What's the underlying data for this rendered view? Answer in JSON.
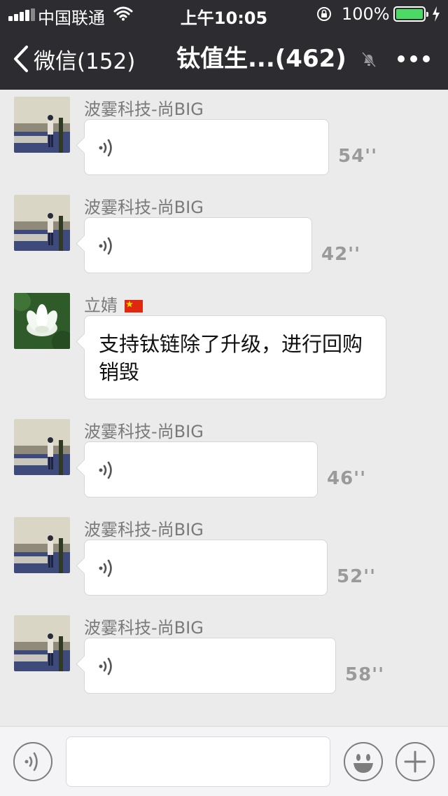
{
  "status_bar": {
    "carrier": "中国联通",
    "time": "上午10:05",
    "battery_percent": "100%",
    "battery_level": 1.0
  },
  "nav": {
    "back_label": "微信(152)",
    "title": "钛值生...(462)",
    "muted": true
  },
  "messages": [
    {
      "type": "voice",
      "sender": "波霎科技-尚BIG",
      "duration": "54''",
      "avatar": "city-avatar"
    },
    {
      "type": "voice",
      "sender": "波霎科技-尚BIG",
      "duration": "42''",
      "avatar": "city-avatar"
    },
    {
      "type": "text",
      "sender": "立婧",
      "sender_flag": "china-flag-icon",
      "text": "支持钛链除了升级，进行回购销毁",
      "avatar": "lotus-avatar"
    },
    {
      "type": "voice",
      "sender": "波霎科技-尚BIG",
      "duration": "46''",
      "avatar": "city-avatar"
    },
    {
      "type": "voice",
      "sender": "波霎科技-尚BIG",
      "duration": "52''",
      "avatar": "city-avatar"
    },
    {
      "type": "voice",
      "sender": "波霎科技-尚BIG",
      "duration": "58''",
      "avatar": "city-avatar"
    }
  ],
  "bottom_bar": {
    "input_value": "",
    "icons": [
      "voice-input-icon",
      "emoji-icon",
      "plus-icon"
    ]
  },
  "colors": {
    "header_bg": "#2d2d31",
    "chat_bg": "#ebebeb",
    "battery_green": "#4cd964"
  }
}
